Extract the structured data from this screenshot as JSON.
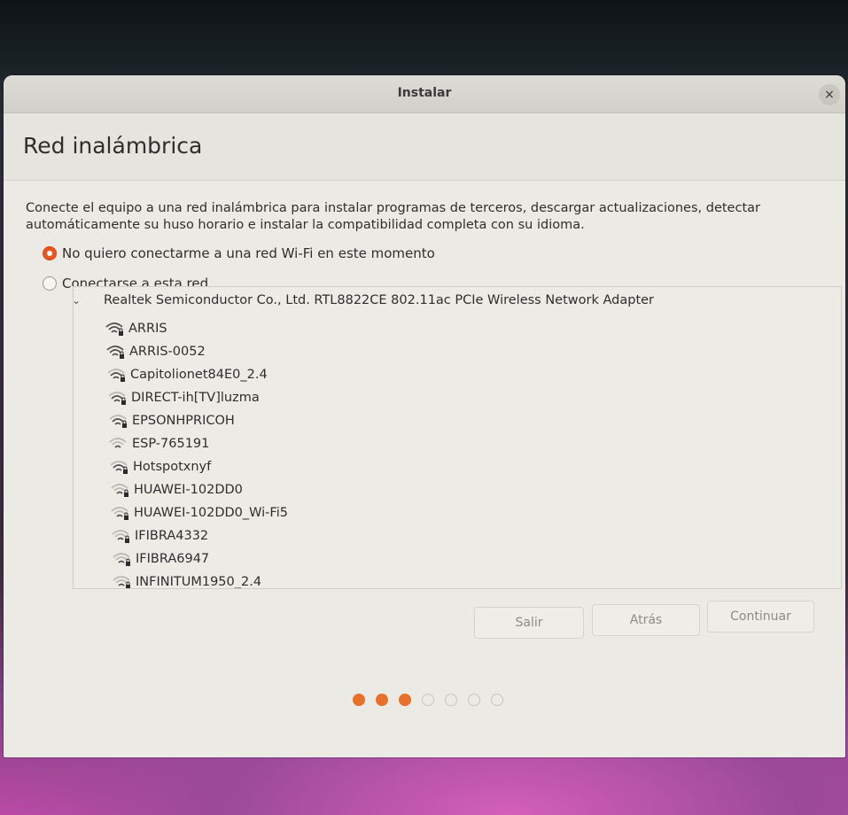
{
  "window": {
    "title": "Instalar",
    "close_label": "×"
  },
  "page": {
    "heading": "Red inalámbrica",
    "description": "Conecte el equipo a una red inalámbrica para instalar programas de terceros, descargar actualizaciones, detectar automáticamente su huso horario e instalar la compatibilidad completa con su idioma."
  },
  "options": {
    "no_connect_label": "No quiero conectarme a una red Wi-Fi en este momento",
    "no_connect_selected": true,
    "connect_label": "Conectarse a esta red",
    "connect_selected": false
  },
  "adapter": {
    "label": "Realtek Semiconductor Co., Ltd. RTL8822CE 802.11ac PCIe Wireless Network Adapter",
    "expanded": true
  },
  "networks": [
    {
      "ssid": "ARRIS",
      "secured": true,
      "signal": 3
    },
    {
      "ssid": "ARRIS-0052",
      "secured": true,
      "signal": 3
    },
    {
      "ssid": "Capitolionet84E0_2.4",
      "secured": true,
      "signal": 2
    },
    {
      "ssid": "DIRECT-ih[TV]luzma",
      "secured": true,
      "signal": 2
    },
    {
      "ssid": "EPSONHPRICOH",
      "secured": true,
      "signal": 2
    },
    {
      "ssid": "ESP-765191",
      "secured": false,
      "signal": 1
    },
    {
      "ssid": "Hotspotxnyf",
      "secured": true,
      "signal": 2
    },
    {
      "ssid": "HUAWEI-102DD0",
      "secured": true,
      "signal": 1
    },
    {
      "ssid": "HUAWEI-102DD0_Wi-Fi5",
      "secured": true,
      "signal": 1
    },
    {
      "ssid": "IFIBRA4332",
      "secured": true,
      "signal": 1
    },
    {
      "ssid": "IFIBRA6947",
      "secured": true,
      "signal": 1
    },
    {
      "ssid": "INFINITUM1950_2.4",
      "secured": true,
      "signal": 1
    }
  ],
  "buttons": {
    "quit": "Salir",
    "back": "Atrás",
    "continue": "Continuar"
  },
  "progress": {
    "total_steps": 7,
    "completed_steps": 3
  },
  "colors": {
    "accent": "#e95420",
    "progress_dot": "#e9702a",
    "window_bg": "#eceae4",
    "titlebar_bg": "#d7d5cf"
  }
}
